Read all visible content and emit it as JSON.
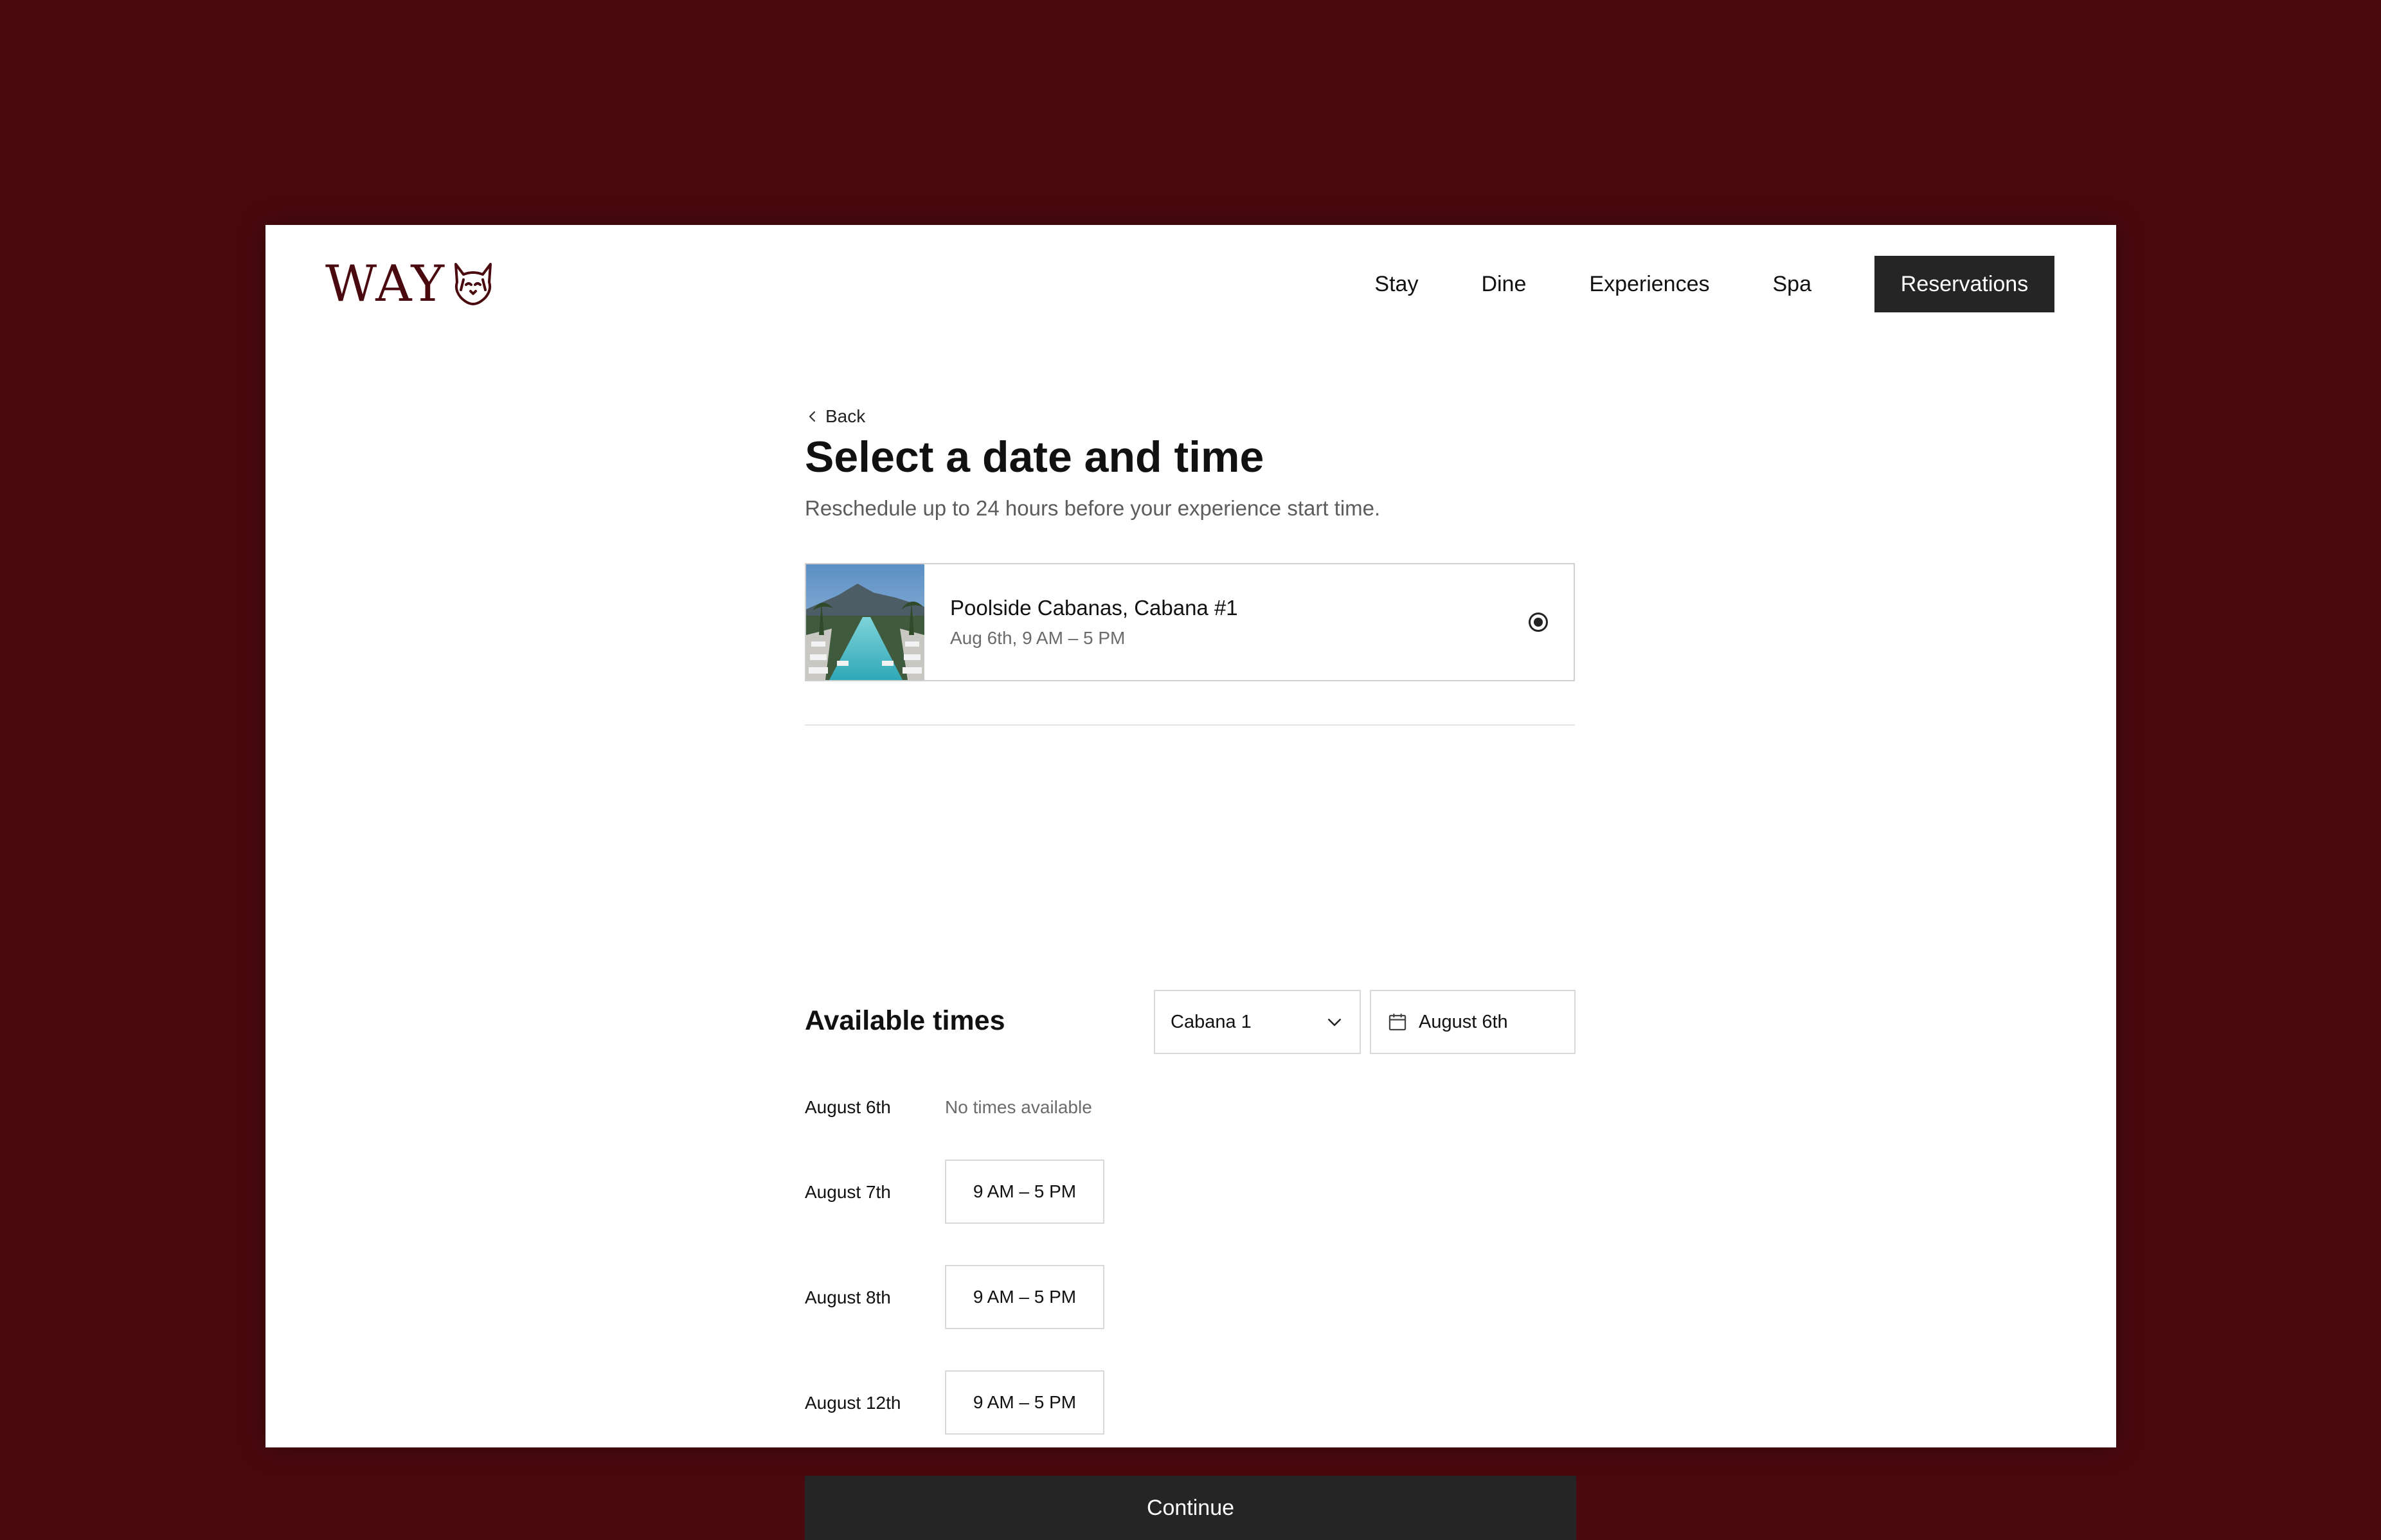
{
  "brand": {
    "name": "WAY",
    "accent_color": "#4a090f"
  },
  "nav": {
    "items": [
      {
        "label": "Stay"
      },
      {
        "label": "Dine"
      },
      {
        "label": "Experiences"
      },
      {
        "label": "Spa"
      }
    ],
    "cta_label": "Reservations"
  },
  "page": {
    "back_label": "Back",
    "title": "Select a date and time",
    "subtitle": "Reschedule up to 24 hours before your experience start time."
  },
  "reservation": {
    "name": "Poolside Cabanas, Cabana #1",
    "datetime": "Aug 6th, 9 AM – 5 PM",
    "selected": true,
    "thumbnail_icon": "pool-thumbnail"
  },
  "availability": {
    "heading": "Available times",
    "cabana_select": {
      "value": "Cabana 1"
    },
    "date_picker": {
      "value": "August 6th"
    },
    "rows": [
      {
        "date": "August 6th",
        "status": "No times available",
        "slots": []
      },
      {
        "date": "August 7th",
        "slots": [
          "9 AM – 5 PM"
        ]
      },
      {
        "date": "August 8th",
        "slots": [
          "9 AM – 5 PM"
        ]
      },
      {
        "date": "August 12th",
        "slots": [
          "9 AM – 5 PM"
        ]
      }
    ]
  },
  "footer": {
    "continue_label": "Continue"
  }
}
